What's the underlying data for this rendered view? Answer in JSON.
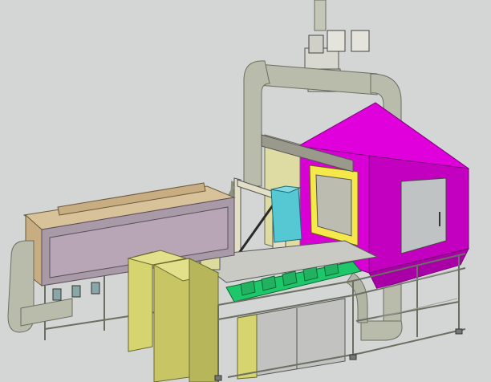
{
  "scene": {
    "type": "3d-cad-model",
    "view": "isometric-shaded",
    "colors": {
      "background": "#d3d6d4",
      "pipe": "#b9bcab",
      "pipe_shadow": "#8f9282",
      "hood": "#e000dc",
      "hood_dark": "#b800b4",
      "hood_side": "#c400c0",
      "tank": "#a89aa6",
      "tank_frame": "#c9ad82",
      "cabinet": "#d6d46e",
      "cabinet_dark": "#b8b65a",
      "window": "#56c8d4",
      "tray": "#1ec86a",
      "frame": "#a9acab",
      "panel_grey": "#c2c3c0"
    },
    "components": [
      {
        "id": "overhead-duct",
        "label": ""
      },
      {
        "id": "dust-collector-hood",
        "label": ""
      },
      {
        "id": "holding-tank",
        "label": ""
      },
      {
        "id": "electrical-cabinet",
        "label": ""
      },
      {
        "id": "inspection-station",
        "label": ""
      },
      {
        "id": "support-frame",
        "label": ""
      }
    ]
  }
}
